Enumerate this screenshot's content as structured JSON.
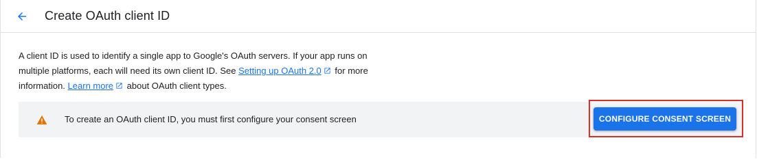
{
  "header": {
    "title": "Create OAuth client ID",
    "back_icon": "arrow-back-icon"
  },
  "intro": {
    "text_1": "A client ID is used to identify a single app to Google's OAuth servers. If your app runs on multiple platforms, each will need its own client ID. See ",
    "link_setup": "Setting up OAuth 2.0",
    "text_2": " for more information. ",
    "link_learn": "Learn more",
    "text_3": " about OAuth client types."
  },
  "banner": {
    "icon": "warning-icon",
    "message": "To create an OAuth client ID, you must first configure your consent screen",
    "button_label": "CONFIGURE CONSENT SCREEN"
  },
  "colors": {
    "accent": "#1a73e8",
    "warning": "#e37400",
    "highlight": "#d93025",
    "banner_bg": "#f1f3f4"
  }
}
